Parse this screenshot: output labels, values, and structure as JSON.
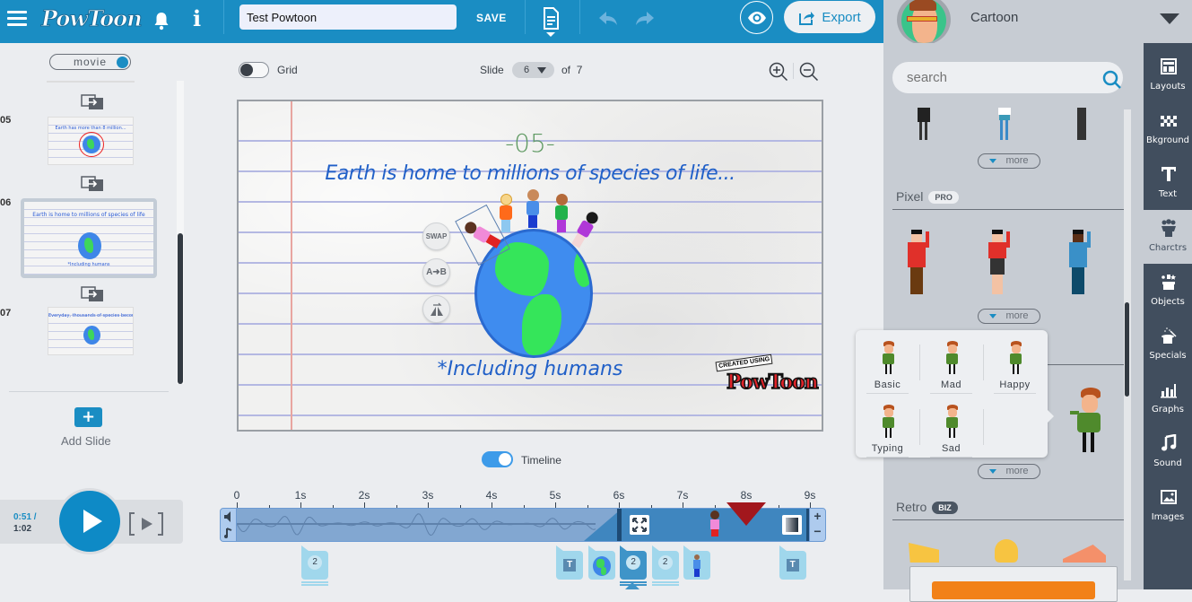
{
  "topbar": {
    "menu_icon": "hamburger-icon",
    "logo_text": "PowToon",
    "notifications_icon": "bell-icon",
    "info_icon": "info-icon",
    "title_value": "Test Powtoon",
    "save_label": "SAVE",
    "document_menu_icon": "document-icon",
    "undo_icon": "undo-icon",
    "redo_icon": "redo-icon",
    "preview_icon": "eye-icon",
    "export_label": "Export",
    "export_icon": "share-icon"
  },
  "style_selector": {
    "name": "Cartoon",
    "avatar": "cartoon-style-avatar"
  },
  "left_panel": {
    "mode_toggle_label": "movie",
    "slides": [
      {
        "number": "05",
        "title": "Earth has more than 8 million...",
        "selected": false
      },
      {
        "number": "06",
        "title": "Earth is home to millions of species of life",
        "selected": true
      },
      {
        "number": "07",
        "title": "Everyday, thousands of species become extinct...",
        "selected": false
      }
    ],
    "add_slide_label": "Add Slide"
  },
  "player": {
    "current_time": "0:51 /",
    "total_time": "1:02"
  },
  "canvas_toolbar": {
    "grid_label": "Grid",
    "grid_on": false,
    "slide_label": "Slide",
    "current_slide": "6",
    "of_label": "of",
    "total_slides": "7"
  },
  "stage": {
    "number_text": "-05-",
    "title_text": "Earth is home to millions of species of life...",
    "subtitle_text": "*Including humans",
    "tools": {
      "swap": "SWAP",
      "ab": "A➜B",
      "flip_icon": "flip-icon"
    },
    "watermark_top": "CREATED USING",
    "watermark_brand": "PowToon"
  },
  "timeline": {
    "label": "Timeline",
    "enabled": true,
    "ticks": [
      "0",
      "1s",
      "2s",
      "3s",
      "4s",
      "5s",
      "6s",
      "7s",
      "8s",
      "9s"
    ],
    "active_range_seconds": [
      6,
      9
    ],
    "playhead_seconds": 8,
    "zoom_in": "+",
    "zoom_out": "−",
    "items": [
      {
        "type": "group",
        "count": "2",
        "at_seconds": 1.2
      },
      {
        "type": "text",
        "label": "T",
        "at_seconds": 5.2
      },
      {
        "type": "image",
        "label": "earth",
        "at_seconds": 5.7
      },
      {
        "type": "group",
        "count": "2",
        "at_seconds": 6.2,
        "selected": true
      },
      {
        "type": "group",
        "count": "2",
        "at_seconds": 6.7
      },
      {
        "type": "character",
        "label": "boy",
        "at_seconds": 7.2
      },
      {
        "type": "text",
        "label": "T",
        "at_seconds": 8.7
      }
    ]
  },
  "library": {
    "search_placeholder": "search",
    "more_label": "more",
    "sections": [
      {
        "title": "",
        "badge": ""
      },
      {
        "title": "Pixel",
        "badge": "PRO"
      },
      {
        "title": "",
        "badge": ""
      },
      {
        "title": "Retro",
        "badge": "BIZ"
      }
    ],
    "poses": [
      "Basic",
      "Mad",
      "Happy",
      "Typing",
      "Sad"
    ]
  },
  "rail": {
    "items": [
      {
        "label": "Layouts",
        "icon": "layouts-icon",
        "active": false
      },
      {
        "label": "Bkground",
        "icon": "background-icon",
        "active": false
      },
      {
        "label": "Text",
        "icon": "text-icon",
        "active": false
      },
      {
        "label": "Charctrs",
        "icon": "characters-icon",
        "active": true
      },
      {
        "label": "Objects",
        "icon": "objects-icon",
        "active": false
      },
      {
        "label": "Specials",
        "icon": "specials-icon",
        "active": false
      },
      {
        "label": "Graphs",
        "icon": "graphs-icon",
        "active": false
      },
      {
        "label": "Sound",
        "icon": "sound-icon",
        "active": false
      },
      {
        "label": "Images",
        "icon": "images-icon",
        "active": false
      }
    ]
  },
  "colors": {
    "brand_blue": "#1a8dc3",
    "rail_dark": "#414e5e",
    "panel_gray": "#c7ccd3",
    "playhead_red": "#a2171d",
    "upgrade_orange": "#f28118"
  }
}
